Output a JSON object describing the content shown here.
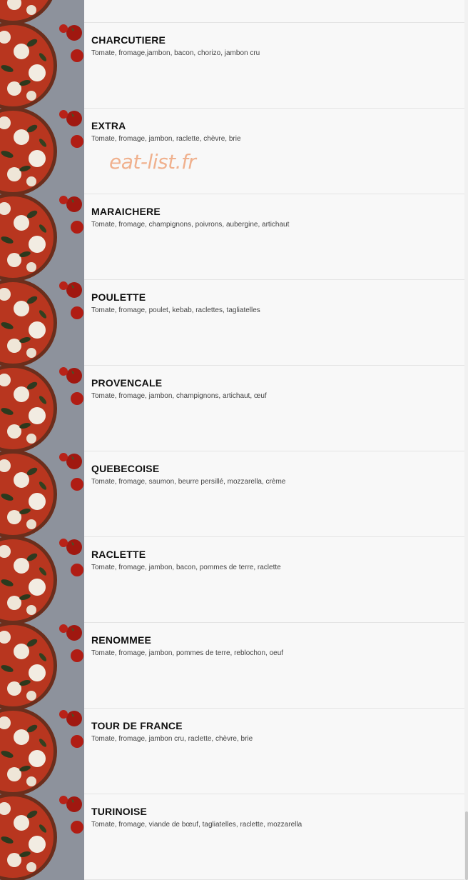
{
  "watermark": "eat-list.fr",
  "items": [
    {
      "name": "",
      "desc": ""
    },
    {
      "name": "CHARCUTIERE",
      "desc": "Tomate, fromage,jambon, bacon, chorizo, jambon cru"
    },
    {
      "name": "EXTRA",
      "desc": "Tomate, fromage, jambon, raclette, chèvre, brie"
    },
    {
      "name": "MARAICHERE",
      "desc": "Tomate, fromage, champignons, poivrons, aubergine, artichaut"
    },
    {
      "name": "POULETTE",
      "desc": "Tomate, fromage, poulet, kebab, raclettes, tagliatelles"
    },
    {
      "name": "PROVENCALE",
      "desc": "Tomate, fromage, jambon, champignons, artichaut, œuf"
    },
    {
      "name": "QUEBECOISE",
      "desc": "Tomate, fromage, saumon, beurre persillé, mozzarella, crème"
    },
    {
      "name": "RACLETTE",
      "desc": "Tomate, fromage, jambon, bacon, pommes de terre, raclette"
    },
    {
      "name": "RENOMMEE",
      "desc": "Tomate, fromage, jambon, pommes de terre, reblochon, oeuf"
    },
    {
      "name": "TOUR DE FRANCE",
      "desc": "Tomate, fromage, jambon cru, raclette, chèvre, brie"
    },
    {
      "name": "TURINOISE",
      "desc": "Tomate, fromage, viande de bœuf, tagliatelles, raclette, mozzarella"
    }
  ],
  "colors": {
    "background": "#f8f8f8",
    "title": "#111111",
    "text": "#444444",
    "watermark": "#f0b18e"
  },
  "icons": {
    "thumbnail": "pizza-image"
  }
}
